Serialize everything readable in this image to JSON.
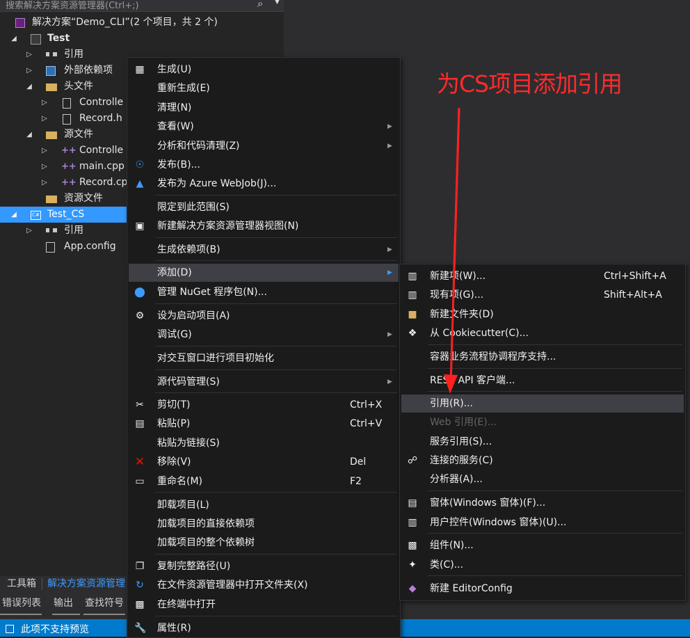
{
  "search": {
    "placeholder": "搜索解决方案资源管理器(Ctrl+;)"
  },
  "tree": {
    "solution": "解决方案“Demo_CLI”(2 个项目，共 2 个)",
    "test": "Test",
    "refs": "引用",
    "external": "外部依赖项",
    "headers": "头文件",
    "controller_h": "Controlle",
    "record_h": "Record.h",
    "sources": "源文件",
    "controller_cpp": "Controlle",
    "main_cpp": "main.cpp",
    "record_cpp": "Record.cp",
    "resources": "资源文件",
    "test_cs": "Test_CS",
    "cs_refs": "引用",
    "app_config": "App.config"
  },
  "annotation": {
    "text": "为CS项目添加引用",
    "color": "#ff2b2b"
  },
  "bottom_tabs": {
    "toolbox": "工具箱",
    "solution_explorer": "解决方案资源管理",
    "error_list": "错误列表",
    "output": "输出",
    "find_symbol": "查找符号"
  },
  "status": {
    "text": "此项不支持预览"
  },
  "context_menu": {
    "build": "生成(U)",
    "rebuild": "重新生成(E)",
    "clean": "清理(N)",
    "view": "查看(W)",
    "analyze": "分析和代码清理(Z)",
    "publish": "发布(B)...",
    "publish_azure": "发布为 Azure WebJob(J)...",
    "scope": "限定到此范围(S)",
    "new_view": "新建解决方案资源管理器视图(N)",
    "build_deps": "生成依赖项(B)",
    "add": "添加(D)",
    "nuget": "管理 NuGet 程序包(N)...",
    "startup": "设为启动项目(A)",
    "debug": "调试(G)",
    "interactive": "对交互窗口进行项目初始化",
    "source_control": "源代码管理(S)",
    "cut": "剪切(T)",
    "cut_sc": "Ctrl+X",
    "paste": "粘贴(P)",
    "paste_sc": "Ctrl+V",
    "paste_link": "粘贴为链接(S)",
    "remove": "移除(V)",
    "remove_sc": "Del",
    "rename": "重命名(M)",
    "rename_sc": "F2",
    "unload": "卸载项目(L)",
    "load_direct": "加载项目的直接依赖项",
    "load_tree": "加载项目的整个依赖树",
    "copy_path": "复制完整路径(U)",
    "open_folder": "在文件资源管理器中打开文件夹(X)",
    "open_terminal": "在终端中打开",
    "properties": "属性(R)"
  },
  "add_menu": {
    "new_item": "新建项(W)...",
    "new_item_sc": "Ctrl+Shift+A",
    "existing": "现有项(G)...",
    "existing_sc": "Shift+Alt+A",
    "new_folder": "新建文件夹(D)",
    "cookiecutter": "从 Cookiecutter(C)...",
    "container": "容器业务流程协调程序支持...",
    "rest": "REST API 客户端...",
    "reference": "引用(R)...",
    "web_ref": "Web 引用(E)...",
    "service_ref": "服务引用(S)...",
    "connected": "连接的服务(C)",
    "analyzer": "分析器(A)...",
    "window": "窗体(Windows 窗体)(F)...",
    "user_control": "用户控件(Windows 窗体)(U)...",
    "component": "组件(N)...",
    "class": "类(C)...",
    "editorconfig": "新建 EditorConfig"
  }
}
